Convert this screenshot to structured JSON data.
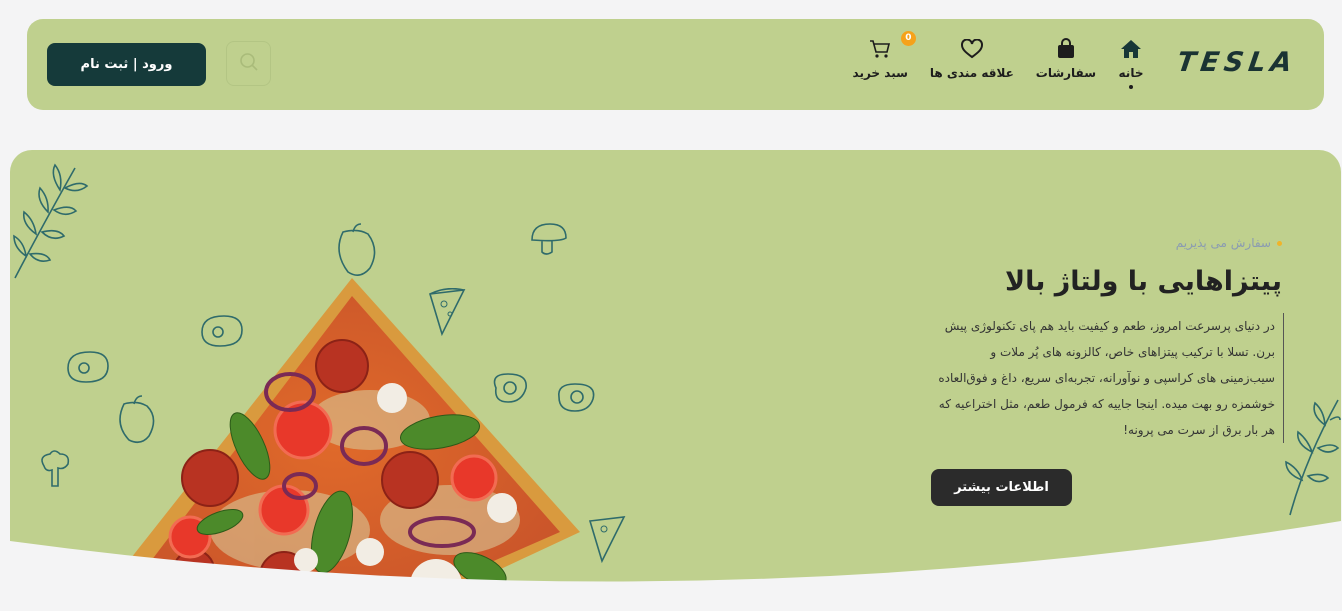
{
  "header": {
    "logo": "TESLA",
    "nav": [
      {
        "label": "خانه",
        "icon": "home-icon",
        "active": true
      },
      {
        "label": "سفارشات",
        "icon": "shopping-bag-icon",
        "active": false
      },
      {
        "label": "علاقه مندی ها",
        "icon": "heart-icon",
        "active": false
      },
      {
        "label": "سبد خرید",
        "icon": "cart-icon",
        "active": false,
        "badge": "0"
      }
    ],
    "search_icon": "search-icon",
    "login_label": "ورود | ثبت نام"
  },
  "hero": {
    "tagline": "سفارش می پذیریم",
    "title": "پیتزاهایی با ولتاژ بالا",
    "description": "در دنیای پرسرعت امروز، طعم و کیفیت باید هم پای تکنولوژی پیش برن. تسلا با ترکیب پیتزاهای خاص، کالزونه های پُر ملات و سیب‌زمینی های کراسپی و نوآورانه، تجربه‌ای سریع، داغ و فوق‌العاده خوشمزه رو بهت میده. اینجا جاییه که فرمول طعم، مثل اختراعیه که هر بار برق از سرت می پرونه!",
    "more_button": "اطلاعات بیشتر"
  },
  "colors": {
    "accent_green": "#bfd08e",
    "dark_teal": "#153a3a",
    "badge_orange": "#f5a21b",
    "button_dark": "#2b2b2b"
  }
}
